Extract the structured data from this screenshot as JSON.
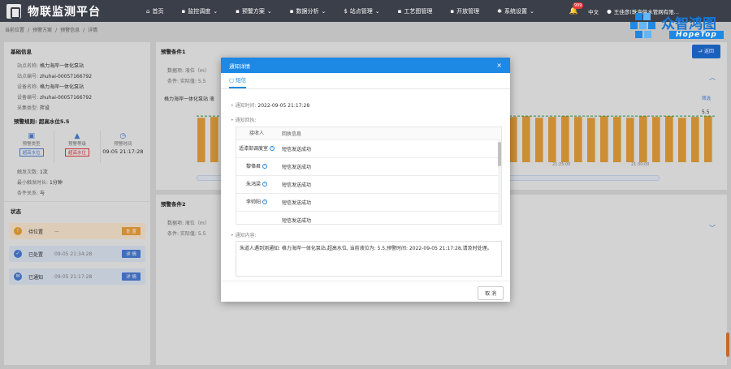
{
  "app": {
    "title": "物联监测平台"
  },
  "nav": [
    {
      "label": "首页",
      "icon": "home-icon",
      "glyph": "⌂"
    },
    {
      "label": "监控调度",
      "icon": "monitor-icon",
      "glyph": "▪",
      "arrow": true
    },
    {
      "label": "预警方案",
      "icon": "warning-icon",
      "glyph": "▪",
      "arrow": true
    },
    {
      "label": "数据分析",
      "icon": "chart-icon",
      "glyph": "▪",
      "arrow": true
    },
    {
      "label": "站点管理",
      "icon": "site-icon",
      "glyph": "$",
      "arrow": true
    },
    {
      "label": "工艺图管理",
      "icon": "diagram-icon",
      "glyph": "▪"
    },
    {
      "label": "开放管理",
      "icon": "open-icon",
      "glyph": "▪"
    },
    {
      "label": "系统设置",
      "icon": "gear-icon",
      "glyph": "✱",
      "arrow": true
    }
  ],
  "user": {
    "badge": "999",
    "lang": "中文",
    "name": "王佳彦(珠海供水管网有限..."
  },
  "brand": {
    "name": "众智鸿图",
    "en": "HopeTop"
  },
  "breadcrumb": [
    "当前位置",
    "/",
    "预警方案",
    "/",
    "预警信息",
    "/",
    "详情"
  ],
  "left": {
    "basic_title": "基础信息",
    "fields": [
      {
        "k": "站点名称:",
        "v": "格力海岸一体化泵站"
      },
      {
        "k": "站点编号:",
        "v": "zhuhai-00057166792"
      },
      {
        "k": "设备名称:",
        "v": "格力海岸一体化泵站"
      },
      {
        "k": "设备编号:",
        "v": "zhuhai-00057166792"
      },
      {
        "k": "采集类型:",
        "v": "拌设"
      }
    ],
    "warn_rule": "预警规则: 超高水位5.5",
    "cards": [
      {
        "label": "预警类型",
        "tag": "超高水位",
        "icon": "warning-type-icon",
        "glyph": "▣"
      },
      {
        "label": "预警等级",
        "tag": "超高水位",
        "icon": "warning-level-icon",
        "glyph": "▲"
      },
      {
        "label": "预警时间",
        "value": "09-05 21:17:28",
        "icon": "clock-icon",
        "glyph": "◷"
      }
    ],
    "rules": [
      {
        "k": "触发次数:",
        "v": "1次"
      },
      {
        "k": "最小触发时长:",
        "v": "1分钟"
      },
      {
        "k": "条件关系:",
        "v": "与"
      }
    ],
    "status_title": "状态",
    "statuses": [
      {
        "label": "待位置",
        "time": "—",
        "btn": "处 置",
        "color": "#f0a23a",
        "bg": "#fbe9d2",
        "icon": "pending-icon",
        "glyph": "!"
      },
      {
        "label": "已处置",
        "time": "09-05 21:34:28",
        "btn": "详 情",
        "color": "#4a7ed6",
        "bg": "#dfe7f5",
        "icon": "handled-icon",
        "glyph": "✓"
      },
      {
        "label": "已通知",
        "time": "09-05 21:17:28",
        "btn": "详 情",
        "color": "#4a7ed6",
        "bg": "#dfe7f5",
        "icon": "notified-icon",
        "glyph": "✉"
      }
    ]
  },
  "main": {
    "cond1_title": "预警条件1",
    "back_label": "返回",
    "cond1_lines": [
      "数据项: 液位（m）",
      "条件: 实际值: 5.5"
    ],
    "chart_title": "格力海岸一体化泵站 液",
    "chart_right": "筛选",
    "chart_threshold": "5.5",
    "time_labels": [
      "21:25:00",
      "21:30:00"
    ],
    "cond2_title": "预警条件2",
    "cond2_lines": [
      "数据项: 液位（m）",
      "条件: 实际值: 5.5"
    ]
  },
  "chart_data": {
    "type": "bar",
    "title": "",
    "series": [
      {
        "name": "",
        "values": [
          5.3,
          5.4,
          5.3,
          5.5,
          5.4,
          5.5,
          5.3,
          5.4,
          5.5,
          5.3,
          5.4,
          5.5,
          5.3,
          5.4,
          5.5,
          5.4,
          5.3,
          5.5,
          5.4,
          5.3,
          5.5,
          5.4,
          5.3,
          5.5,
          5.4,
          5.5,
          5.3,
          5.4,
          5.5,
          5.4,
          5.3,
          5.5,
          5.4,
          5.3,
          5.5,
          5.4,
          5.5,
          5.3,
          5.4,
          5.5
        ]
      }
    ],
    "ylim": [
      0,
      6
    ],
    "threshold": 5.5
  },
  "modal": {
    "title": "通知详情",
    "tab": "短信",
    "time_label": "通知时间:",
    "time_value": "2022-09-05 21:17:28",
    "recipients_label": "通知回执:",
    "col1": "接收人",
    "col2": "回执信息",
    "rows": [
      {
        "name": "适漆部调度室",
        "status": "短信发送成功"
      },
      {
        "name": "黎偉君",
        "status": "短信发送成功"
      },
      {
        "name": "朱鸿梁",
        "status": "短信发送成功"
      },
      {
        "name": "李帅阳",
        "status": "短信发送成功"
      },
      {
        "name": "",
        "status": "短信发送成功"
      }
    ],
    "content_label": "通知内容:",
    "content": "朱道人遇到测通知: 格力海岸一体化泵站,超高水位, 当前液位为: 5.5,预警时间: 2022-09-05 21:17:28,请及时处理。",
    "cancel": "取 消",
    "close": "×"
  }
}
